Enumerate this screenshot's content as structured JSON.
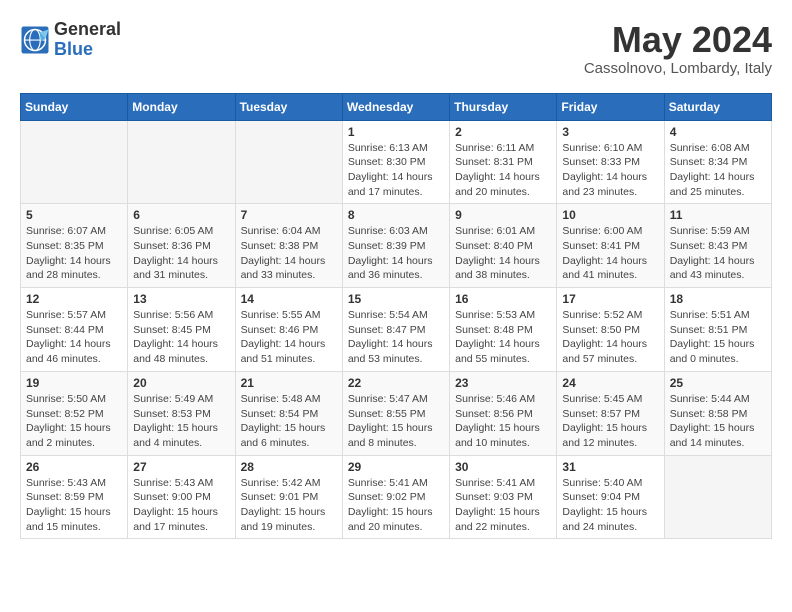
{
  "logo": {
    "general": "General",
    "blue": "Blue"
  },
  "title": {
    "month": "May 2024",
    "location": "Cassolnovo, Lombardy, Italy"
  },
  "days_of_week": [
    "Sunday",
    "Monday",
    "Tuesday",
    "Wednesday",
    "Thursday",
    "Friday",
    "Saturday"
  ],
  "weeks": [
    [
      {
        "day": "",
        "info": ""
      },
      {
        "day": "",
        "info": ""
      },
      {
        "day": "",
        "info": ""
      },
      {
        "day": "1",
        "info": "Sunrise: 6:13 AM\nSunset: 8:30 PM\nDaylight: 14 hours\nand 17 minutes."
      },
      {
        "day": "2",
        "info": "Sunrise: 6:11 AM\nSunset: 8:31 PM\nDaylight: 14 hours\nand 20 minutes."
      },
      {
        "day": "3",
        "info": "Sunrise: 6:10 AM\nSunset: 8:33 PM\nDaylight: 14 hours\nand 23 minutes."
      },
      {
        "day": "4",
        "info": "Sunrise: 6:08 AM\nSunset: 8:34 PM\nDaylight: 14 hours\nand 25 minutes."
      }
    ],
    [
      {
        "day": "5",
        "info": "Sunrise: 6:07 AM\nSunset: 8:35 PM\nDaylight: 14 hours\nand 28 minutes."
      },
      {
        "day": "6",
        "info": "Sunrise: 6:05 AM\nSunset: 8:36 PM\nDaylight: 14 hours\nand 31 minutes."
      },
      {
        "day": "7",
        "info": "Sunrise: 6:04 AM\nSunset: 8:38 PM\nDaylight: 14 hours\nand 33 minutes."
      },
      {
        "day": "8",
        "info": "Sunrise: 6:03 AM\nSunset: 8:39 PM\nDaylight: 14 hours\nand 36 minutes."
      },
      {
        "day": "9",
        "info": "Sunrise: 6:01 AM\nSunset: 8:40 PM\nDaylight: 14 hours\nand 38 minutes."
      },
      {
        "day": "10",
        "info": "Sunrise: 6:00 AM\nSunset: 8:41 PM\nDaylight: 14 hours\nand 41 minutes."
      },
      {
        "day": "11",
        "info": "Sunrise: 5:59 AM\nSunset: 8:43 PM\nDaylight: 14 hours\nand 43 minutes."
      }
    ],
    [
      {
        "day": "12",
        "info": "Sunrise: 5:57 AM\nSunset: 8:44 PM\nDaylight: 14 hours\nand 46 minutes."
      },
      {
        "day": "13",
        "info": "Sunrise: 5:56 AM\nSunset: 8:45 PM\nDaylight: 14 hours\nand 48 minutes."
      },
      {
        "day": "14",
        "info": "Sunrise: 5:55 AM\nSunset: 8:46 PM\nDaylight: 14 hours\nand 51 minutes."
      },
      {
        "day": "15",
        "info": "Sunrise: 5:54 AM\nSunset: 8:47 PM\nDaylight: 14 hours\nand 53 minutes."
      },
      {
        "day": "16",
        "info": "Sunrise: 5:53 AM\nSunset: 8:48 PM\nDaylight: 14 hours\nand 55 minutes."
      },
      {
        "day": "17",
        "info": "Sunrise: 5:52 AM\nSunset: 8:50 PM\nDaylight: 14 hours\nand 57 minutes."
      },
      {
        "day": "18",
        "info": "Sunrise: 5:51 AM\nSunset: 8:51 PM\nDaylight: 15 hours\nand 0 minutes."
      }
    ],
    [
      {
        "day": "19",
        "info": "Sunrise: 5:50 AM\nSunset: 8:52 PM\nDaylight: 15 hours\nand 2 minutes."
      },
      {
        "day": "20",
        "info": "Sunrise: 5:49 AM\nSunset: 8:53 PM\nDaylight: 15 hours\nand 4 minutes."
      },
      {
        "day": "21",
        "info": "Sunrise: 5:48 AM\nSunset: 8:54 PM\nDaylight: 15 hours\nand 6 minutes."
      },
      {
        "day": "22",
        "info": "Sunrise: 5:47 AM\nSunset: 8:55 PM\nDaylight: 15 hours\nand 8 minutes."
      },
      {
        "day": "23",
        "info": "Sunrise: 5:46 AM\nSunset: 8:56 PM\nDaylight: 15 hours\nand 10 minutes."
      },
      {
        "day": "24",
        "info": "Sunrise: 5:45 AM\nSunset: 8:57 PM\nDaylight: 15 hours\nand 12 minutes."
      },
      {
        "day": "25",
        "info": "Sunrise: 5:44 AM\nSunset: 8:58 PM\nDaylight: 15 hours\nand 14 minutes."
      }
    ],
    [
      {
        "day": "26",
        "info": "Sunrise: 5:43 AM\nSunset: 8:59 PM\nDaylight: 15 hours\nand 15 minutes."
      },
      {
        "day": "27",
        "info": "Sunrise: 5:43 AM\nSunset: 9:00 PM\nDaylight: 15 hours\nand 17 minutes."
      },
      {
        "day": "28",
        "info": "Sunrise: 5:42 AM\nSunset: 9:01 PM\nDaylight: 15 hours\nand 19 minutes."
      },
      {
        "day": "29",
        "info": "Sunrise: 5:41 AM\nSunset: 9:02 PM\nDaylight: 15 hours\nand 20 minutes."
      },
      {
        "day": "30",
        "info": "Sunrise: 5:41 AM\nSunset: 9:03 PM\nDaylight: 15 hours\nand 22 minutes."
      },
      {
        "day": "31",
        "info": "Sunrise: 5:40 AM\nSunset: 9:04 PM\nDaylight: 15 hours\nand 24 minutes."
      },
      {
        "day": "",
        "info": ""
      }
    ]
  ]
}
